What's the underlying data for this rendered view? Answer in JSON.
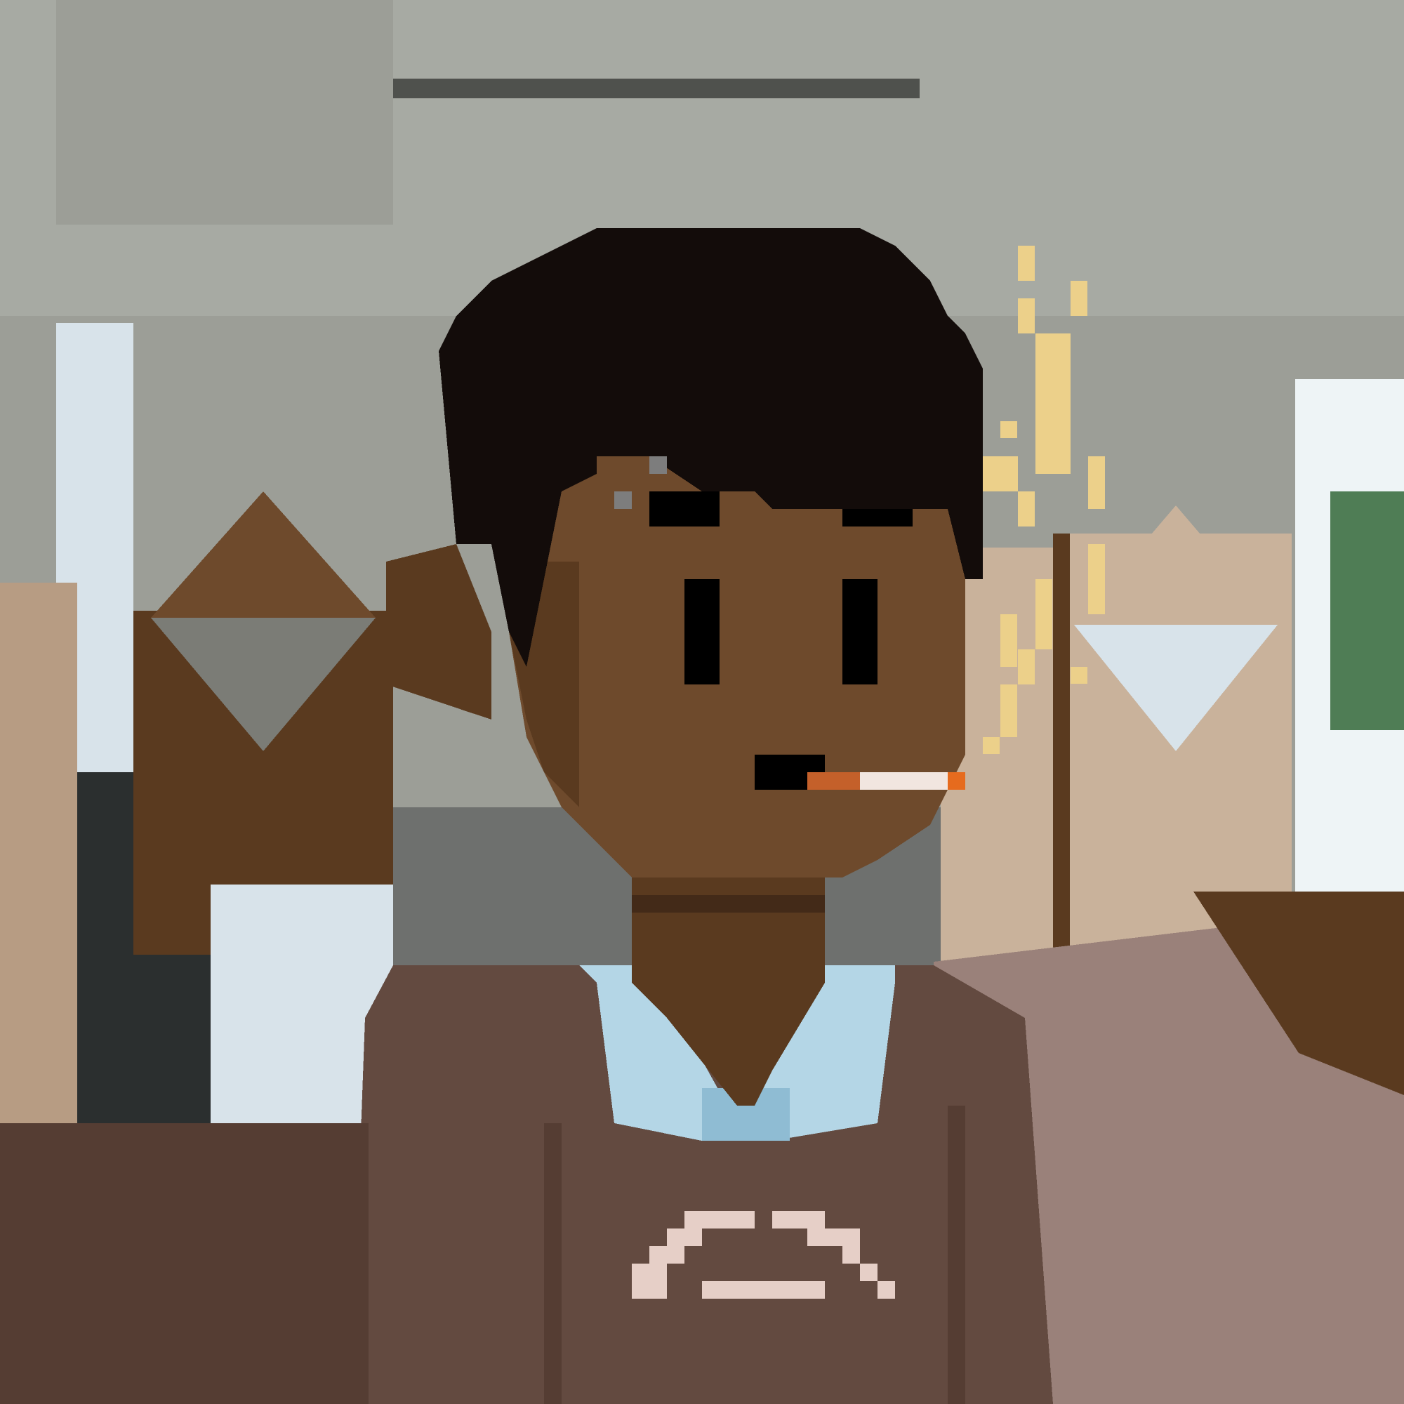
{
  "artwork": {
    "style": "pixel-art portrait",
    "subject": "avatar-with-cigarette",
    "palette": {
      "background_wall": "#9c9e97",
      "ceiling": "#a7aaa3",
      "ceiling_beam": "#4f514d",
      "wood_panel": "#5a3a1f",
      "wood_panel_light": "#b79c83",
      "curtain_light": "#c9b29b",
      "window_light": "#d8e3ea",
      "window_green": "#4f7d55",
      "hair": "#130c0a",
      "skin": "#6e4a2c",
      "skin_shadow": "#5a3a1f",
      "eyes": "#000000",
      "mouth": "#000000",
      "cigarette_filter": "#c4602a",
      "cigarette_paper": "#f1e6e0",
      "cigarette_ember": "#e66b1e",
      "smoke": "#ecd08a",
      "shirt": "#634a40",
      "shirt_shadow": "#553d33",
      "collar": "#b4d6e6",
      "collar_shadow": "#8fbcd3",
      "shirt_print": "#e6cfc7",
      "floor": "#9a817a"
    }
  }
}
